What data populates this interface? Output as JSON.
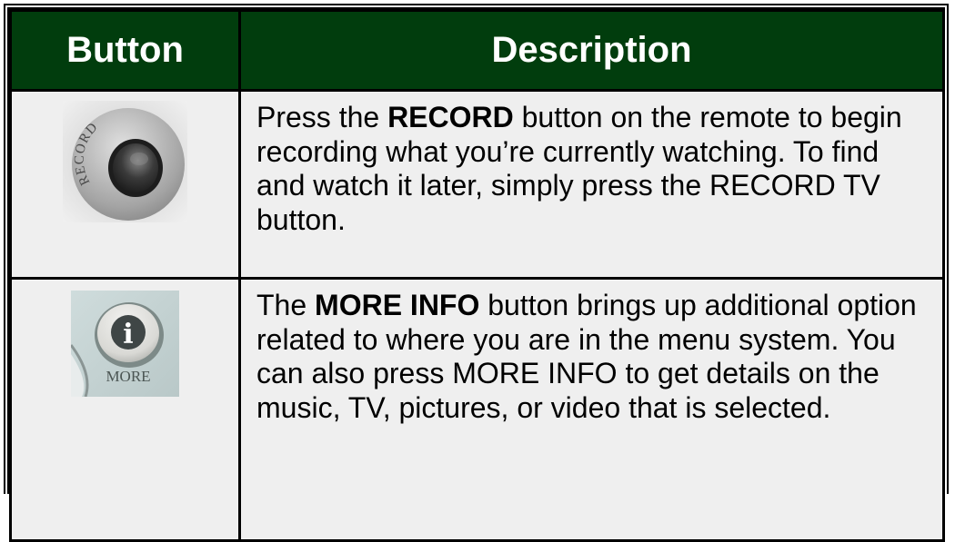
{
  "table": {
    "header": {
      "col_button": "Button",
      "col_description": "Description"
    },
    "rows": [
      {
        "icon_name": "record-button-icon",
        "icon_label": "RECORD",
        "desc_pre": "Press the ",
        "desc_bold": "RECORD",
        "desc_post": " button on the remote to begin recording what you’re currently watching. To find and watch it later, simply press the RECORD TV button."
      },
      {
        "icon_name": "more-info-button-icon",
        "icon_glyph": "i",
        "icon_label": "MORE",
        "desc_pre": "The ",
        "desc_bold": "MORE INFO",
        "desc_post": " button brings up additional option related to where you are in the menu system. You can also press MORE INFO to get details on the music, TV, pictures, or video that is selected."
      }
    ]
  },
  "colors": {
    "header_bg": "#013d0d",
    "header_text": "#ffffff",
    "cell_bg": "#efefef"
  }
}
